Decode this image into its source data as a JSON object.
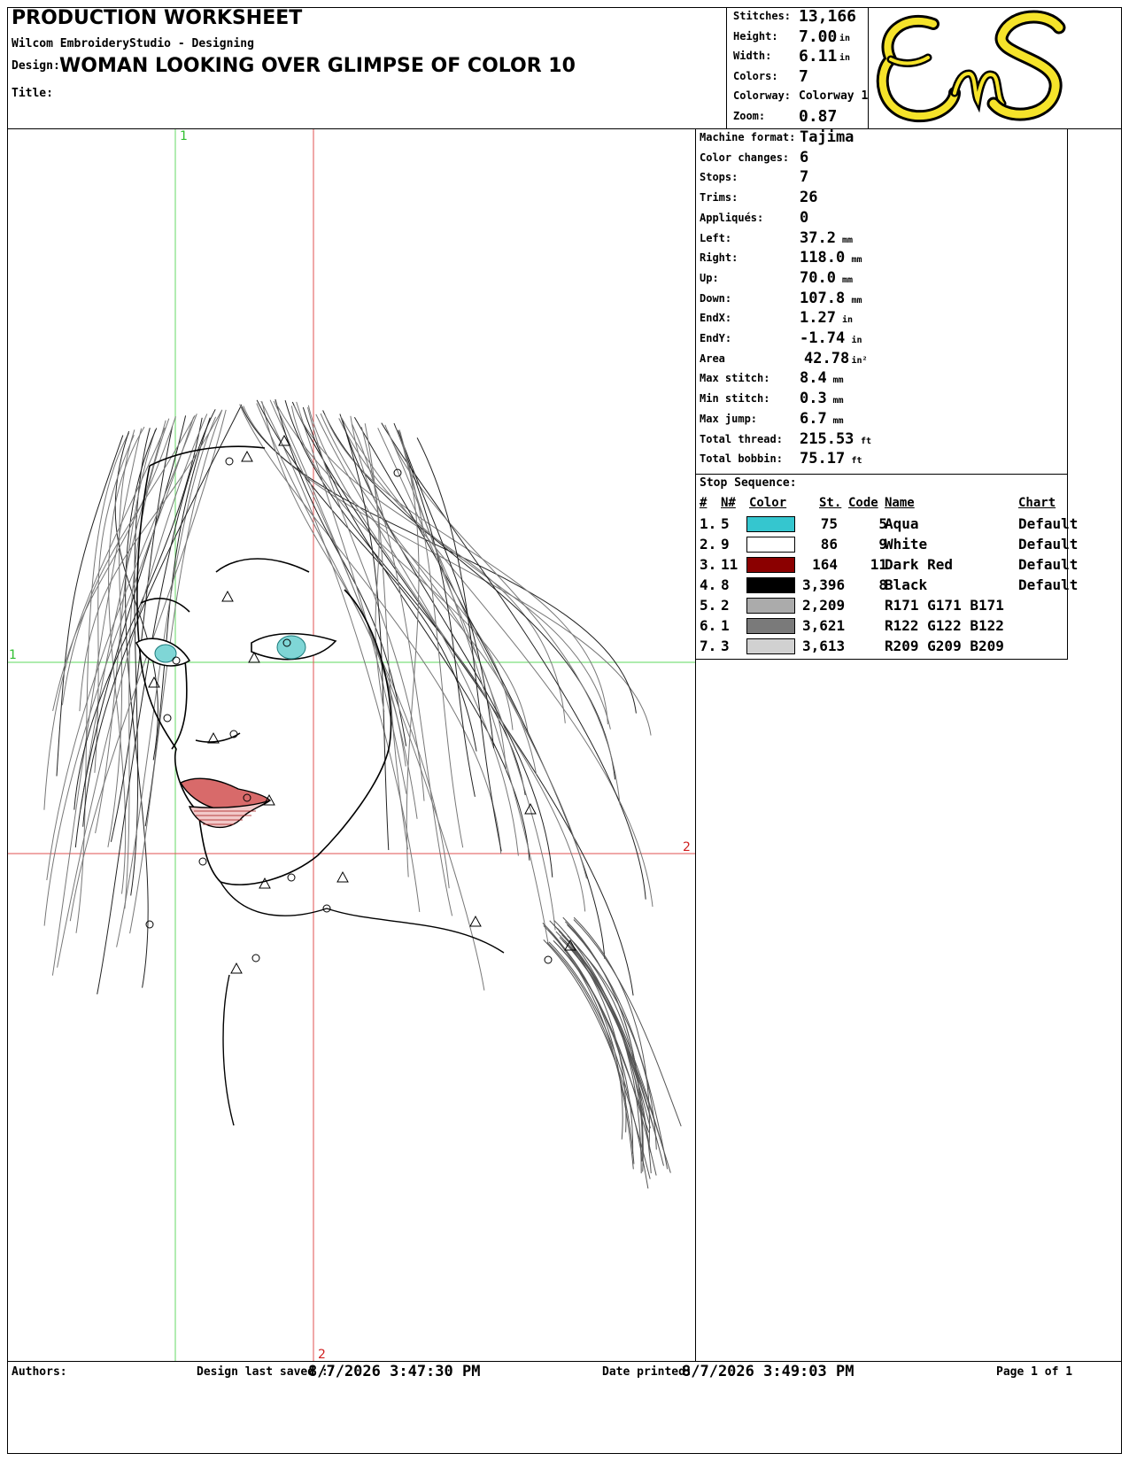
{
  "header": {
    "title": "PRODUCTION WORKSHEET",
    "software": "Wilcom EmbroideryStudio - Designing",
    "design_label": "Design:",
    "design_name": "WOMAN LOOKING OVER GLIMPSE OF COLOR  10",
    "title_label": "Title:"
  },
  "summary": [
    {
      "label": "Stitches:",
      "value": "13,166",
      "unit": ""
    },
    {
      "label": "Height:",
      "value": "7.00",
      "unit": "in"
    },
    {
      "label": "Width:",
      "value": "6.11",
      "unit": "in"
    },
    {
      "label": "Colors:",
      "value": "7",
      "unit": ""
    },
    {
      "label": "Colorway:",
      "value": "Colorway 1",
      "unit": ""
    },
    {
      "label": "Zoom:",
      "value": "0.87",
      "unit": ""
    }
  ],
  "logo": {
    "text": "EnS",
    "fill": "#f5e32a",
    "stroke": "#000000"
  },
  "stats": [
    {
      "label": "Machine format:",
      "value": "Tajima",
      "unit": ""
    },
    {
      "label": "Color changes:",
      "value": "6",
      "unit": ""
    },
    {
      "label": "Stops:",
      "value": "7",
      "unit": ""
    },
    {
      "label": "Trims:",
      "value": "26",
      "unit": ""
    },
    {
      "label": "Appliqués:",
      "value": "0",
      "unit": ""
    },
    {
      "label": "Left:",
      "value": "37.2",
      "unit": "mm"
    },
    {
      "label": "Right:",
      "value": "118.0",
      "unit": "mm"
    },
    {
      "label": "Up:",
      "value": "70.0",
      "unit": "mm"
    },
    {
      "label": "Down:",
      "value": "107.8",
      "unit": "mm"
    },
    {
      "label": "EndX:",
      "value": "1.27",
      "unit": "in"
    },
    {
      "label": "EndY:",
      "value": "-1.74",
      "unit": "in"
    },
    {
      "label": "Area",
      "value": "42.78",
      "unit": "in²"
    },
    {
      "label": "Max stitch:",
      "value": "8.4",
      "unit": "mm"
    },
    {
      "label": "Min stitch:",
      "value": "0.3",
      "unit": "mm"
    },
    {
      "label": "Max jump:",
      "value": "6.7",
      "unit": "mm"
    },
    {
      "label": "Total thread:",
      "value": "215.53",
      "unit": "ft"
    },
    {
      "label": "Total bobbin:",
      "value": "75.17",
      "unit": "ft"
    }
  ],
  "stop_sequence": {
    "title": "Stop Sequence:",
    "headers": {
      "num": "#",
      "n": "N#",
      "color": "Color",
      "st": "St.",
      "code": "Code",
      "name": "Name",
      "chart": "Chart"
    },
    "rows": [
      {
        "num": "1.",
        "n": "5",
        "hex": "#35c6cf",
        "st": "75",
        "code": "5",
        "name": "Aqua",
        "chart": "Default"
      },
      {
        "num": "2.",
        "n": "9",
        "hex": "#ffffff",
        "st": "86",
        "code": "9",
        "name": "White",
        "chart": "Default"
      },
      {
        "num": "3.",
        "n": "11",
        "hex": "#8b0000",
        "st": "164",
        "code": "11",
        "name": "Dark Red",
        "chart": "Default"
      },
      {
        "num": "4.",
        "n": "8",
        "hex": "#000000",
        "st": "3,396",
        "code": "8",
        "name": "Black",
        "chart": "Default"
      },
      {
        "num": "5.",
        "n": "2",
        "hex": "#ababab",
        "st": "2,209",
        "code": "",
        "name": "R171 G171 B171",
        "chart": ""
      },
      {
        "num": "6.",
        "n": "1",
        "hex": "#7a7a7a",
        "st": "3,621",
        "code": "",
        "name": "R122 G122 B122",
        "chart": ""
      },
      {
        "num": "7.",
        "n": "3",
        "hex": "#d1d1d1",
        "st": "3,613",
        "code": "",
        "name": "R209 G209 B209",
        "chart": ""
      }
    ]
  },
  "guides": {
    "green": "1",
    "red": "2"
  },
  "footer": {
    "authors_label": "Authors:",
    "saved_label": "Design last saved :",
    "saved_value": "8/7/2026 3:47:30 PM",
    "printed_label": "Date printed:",
    "printed_value": "8/7/2026 3:49:03 PM",
    "page_label": "Page 1 of 1"
  }
}
